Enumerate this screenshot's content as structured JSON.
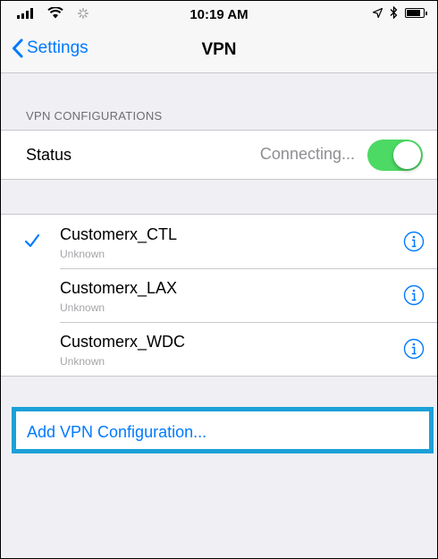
{
  "status_bar": {
    "time": "10:19 AM"
  },
  "nav": {
    "back_label": "Settings",
    "title": "VPN"
  },
  "vpn_section": {
    "header": "VPN CONFIGURATIONS",
    "status_label": "Status",
    "status_value": "Connecting...",
    "toggle_on": true
  },
  "configurations": [
    {
      "name": "Customerx_CTL",
      "subtitle": "Unknown",
      "selected": true
    },
    {
      "name": "Customerx_LAX",
      "subtitle": "Unknown",
      "selected": false
    },
    {
      "name": "Customerx_WDC",
      "subtitle": "Unknown",
      "selected": false
    }
  ],
  "add_config_label": "Add VPN Configuration...",
  "colors": {
    "accent": "#007aff",
    "toggle_on": "#4cd964",
    "highlight_border": "#1ca0d8"
  }
}
